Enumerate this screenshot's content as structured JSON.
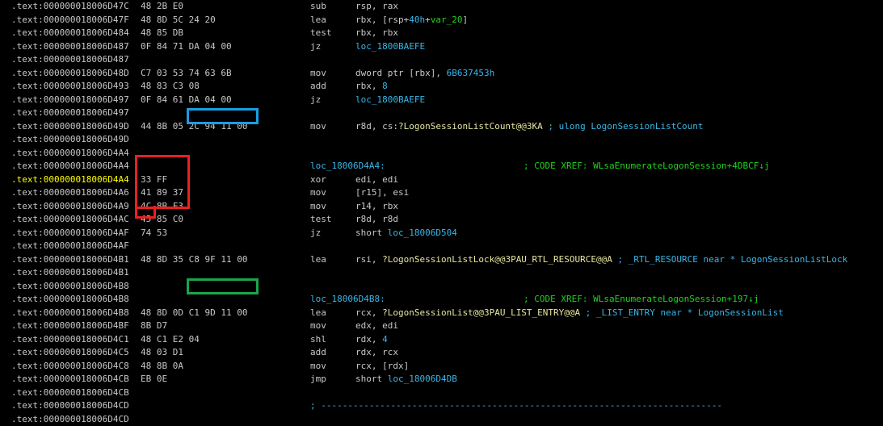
{
  "colors": {
    "background": "#000000",
    "text": "#c8c8c8",
    "highlight_address": "#ffff00",
    "label": "#38b6e8",
    "comment": "#1fd31f",
    "box_blue": "#1b9de2",
    "box_red": "#ea2020",
    "box_green": "#1aa54a"
  },
  "lines": [
    {
      "addr": ".text:000000018006D47C",
      "bytes": "48 2B E0",
      "mnem": "sub",
      "ops": [
        [
          "rsp, rax",
          "w"
        ]
      ]
    },
    {
      "addr": ".text:000000018006D47F",
      "bytes": "48 8D 5C 24 20",
      "mnem": "lea",
      "ops": [
        [
          "rbx, [rsp+",
          "w"
        ],
        [
          "40h",
          "n"
        ],
        [
          "+",
          "w"
        ],
        [
          "var_20",
          "g"
        ],
        [
          "]",
          "w"
        ]
      ]
    },
    {
      "addr": ".text:000000018006D484",
      "bytes": "48 85 DB",
      "mnem": "test",
      "ops": [
        [
          "rbx, rbx",
          "w"
        ]
      ]
    },
    {
      "addr": ".text:000000018006D487",
      "bytes": "0F 84 71 DA 04 00",
      "mnem": "jz",
      "ops": [
        [
          "loc_1800BAEFE",
          "c"
        ]
      ]
    },
    {
      "addr": ".text:000000018006D487",
      "bytes": "",
      "mnem": "",
      "ops": []
    },
    {
      "addr": ".text:000000018006D48D",
      "bytes": "C7 03 53 74 63 6B",
      "mnem": "mov",
      "ops": [
        [
          "dword ptr [rbx], ",
          "w"
        ],
        [
          "6B637453h",
          "n"
        ]
      ]
    },
    {
      "addr": ".text:000000018006D493",
      "bytes": "48 83 C3 08",
      "mnem": "add",
      "ops": [
        [
          "rbx, ",
          "w"
        ],
        [
          "8",
          "n"
        ]
      ]
    },
    {
      "addr": ".text:000000018006D497",
      "bytes": "0F 84 61 DA 04 00",
      "mnem": "jz",
      "ops": [
        [
          "loc_1800BAEFE",
          "c"
        ]
      ]
    },
    {
      "addr": ".text:000000018006D497",
      "bytes": "",
      "mnem": "",
      "ops": []
    },
    {
      "addr": ".text:000000018006D49D",
      "bytes": "44 8B 05 2C 94 11 00",
      "mnem": "mov",
      "ops": [
        [
          "r8d, cs:",
          "w"
        ],
        [
          "?LogonSessionListCount@@3KA",
          "y"
        ],
        [
          " ; ulong LogonSessionListCount",
          "c"
        ]
      ]
    },
    {
      "addr": ".text:000000018006D49D",
      "bytes": "",
      "mnem": "",
      "ops": []
    },
    {
      "addr": ".text:000000018006D4A4",
      "bytes": "",
      "mnem": "",
      "ops": []
    },
    {
      "addr": ".text:000000018006D4A4",
      "bytes": "",
      "label": "loc_18006D4A4:",
      "xref": "; CODE XREF: WLsaEnumerateLogonSession+4DBCF↓j"
    },
    {
      "addr": ".text:000000018006D4A4",
      "hl": true,
      "bytes": "33 FF",
      "mnem": "xor",
      "ops": [
        [
          "edi, edi",
          "w"
        ]
      ]
    },
    {
      "addr": ".text:000000018006D4A6",
      "bytes": "41 89 37",
      "mnem": "mov",
      "ops": [
        [
          "[r15], esi",
          "w"
        ]
      ]
    },
    {
      "addr": ".text:000000018006D4A9",
      "bytes": "4C 8B F3",
      "mnem": "mov",
      "ops": [
        [
          "r14, rbx",
          "w"
        ]
      ]
    },
    {
      "addr": ".text:000000018006D4AC",
      "bytes": "45 85 C0",
      "mnem": "test",
      "ops": [
        [
          "r8d, r8d",
          "w"
        ]
      ]
    },
    {
      "addr": ".text:000000018006D4AF",
      "bytes": "74 53",
      "mnem": "jz",
      "ops": [
        [
          "short ",
          "w"
        ],
        [
          "loc_18006D504",
          "c"
        ]
      ]
    },
    {
      "addr": ".text:000000018006D4AF",
      "bytes": "",
      "mnem": "",
      "ops": []
    },
    {
      "addr": ".text:000000018006D4B1",
      "bytes": "48 8D 35 C8 9F 11 00",
      "mnem": "lea",
      "ops": [
        [
          "rsi, ",
          "w"
        ],
        [
          "?LogonSessionListLock@@3PAU_RTL_RESOURCE@@A",
          "y"
        ],
        [
          " ; _RTL_RESOURCE near * LogonSessionListLock",
          "c"
        ]
      ]
    },
    {
      "addr": ".text:000000018006D4B1",
      "bytes": "",
      "mnem": "",
      "ops": []
    },
    {
      "addr": ".text:000000018006D4B8",
      "bytes": "",
      "mnem": "",
      "ops": []
    },
    {
      "addr": ".text:000000018006D4B8",
      "bytes": "",
      "label": "loc_18006D4B8:",
      "xref": "; CODE XREF: WLsaEnumerateLogonSession+197↓j"
    },
    {
      "addr": ".text:000000018006D4B8",
      "bytes": "48 8D 0D C1 9D 11 00",
      "mnem": "lea",
      "ops": [
        [
          "rcx, ",
          "w"
        ],
        [
          "?LogonSessionList@@3PAU_LIST_ENTRY@@A",
          "y"
        ],
        [
          " ; _LIST_ENTRY near * LogonSessionList",
          "c"
        ]
      ]
    },
    {
      "addr": ".text:000000018006D4BF",
      "bytes": "8B D7",
      "mnem": "mov",
      "ops": [
        [
          "edx, edi",
          "w"
        ]
      ]
    },
    {
      "addr": ".text:000000018006D4C1",
      "bytes": "48 C1 E2 04",
      "mnem": "shl",
      "ops": [
        [
          "rdx, ",
          "w"
        ],
        [
          "4",
          "n"
        ]
      ]
    },
    {
      "addr": ".text:000000018006D4C5",
      "bytes": "48 03 D1",
      "mnem": "add",
      "ops": [
        [
          "rdx, rcx",
          "w"
        ]
      ]
    },
    {
      "addr": ".text:000000018006D4C8",
      "bytes": "48 8B 0A",
      "mnem": "mov",
      "ops": [
        [
          "rcx, [rdx]",
          "w"
        ]
      ]
    },
    {
      "addr": ".text:000000018006D4CB",
      "bytes": "EB 0E",
      "mnem": "jmp",
      "ops": [
        [
          "short ",
          "w"
        ],
        [
          "loc_18006D4DB",
          "c"
        ]
      ]
    },
    {
      "addr": ".text:000000018006D4CB",
      "bytes": "",
      "mnem": "",
      "ops": []
    },
    {
      "addr": ".text:000000018006D4CD",
      "bytes": "",
      "sep": "; ---------------------------------------------------------------------------"
    },
    {
      "addr": ".text:000000018006D4CD",
      "bytes": "",
      "mnem": "",
      "ops": []
    }
  ]
}
